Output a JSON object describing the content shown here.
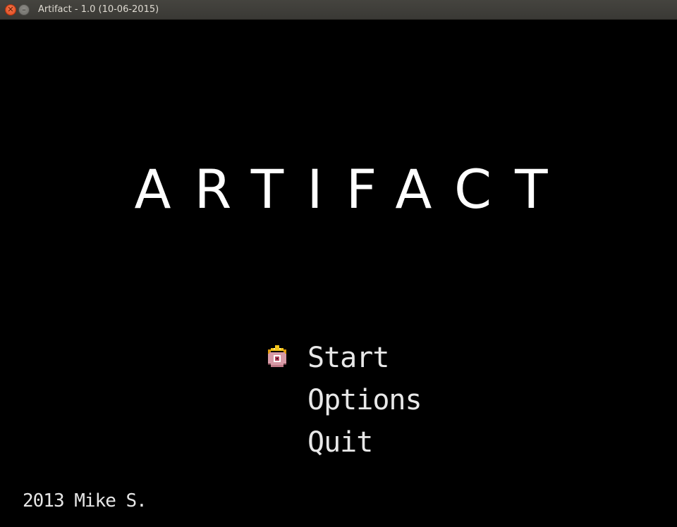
{
  "window": {
    "title": "Artifact - 1.0 (10-06-2015)",
    "close_icon": "close-icon",
    "minimize_icon": "minimize-icon"
  },
  "game": {
    "title": "ARTIFACT",
    "menu": [
      {
        "label": "Start",
        "selected": true
      },
      {
        "label": "Options",
        "selected": false
      },
      {
        "label": "Quit",
        "selected": false
      }
    ],
    "cursor_icon": "crown-orb-cursor-icon",
    "credit": "2013 Mike S."
  },
  "colors": {
    "background": "#000000",
    "text": "#ffffff",
    "close_button": "#e0451c",
    "titlebar": "#3f3e3a"
  }
}
